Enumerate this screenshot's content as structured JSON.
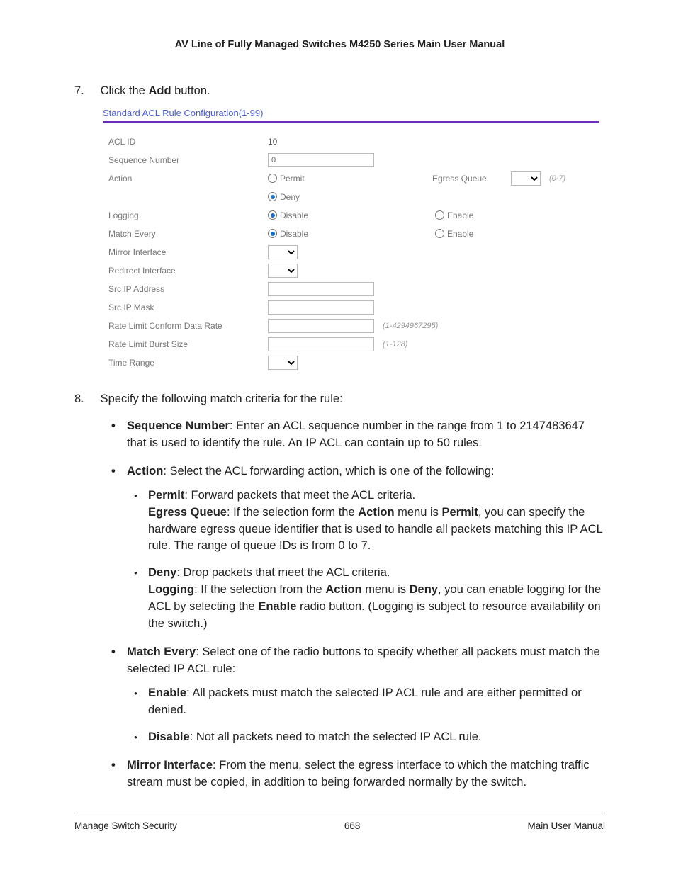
{
  "header": {
    "title": "AV Line of Fully Managed Switches M4250 Series Main User Manual"
  },
  "step7": {
    "num": "7.",
    "pre": "Click the ",
    "bold": "Add",
    "post": " button."
  },
  "panel": {
    "title": "Standard ACL Rule Configuration(1-99)",
    "rows": {
      "acl_id": {
        "label": "ACL ID",
        "value": "10"
      },
      "seq": {
        "label": "Sequence Number",
        "value": "0"
      },
      "action": {
        "label": "Action",
        "opt1": "Permit",
        "opt2": "Deny",
        "right_label": "Egress Queue",
        "hint": "(0-7)"
      },
      "logging": {
        "label": "Logging",
        "opt1": "Disable",
        "opt2": "Enable"
      },
      "match_every": {
        "label": "Match Every",
        "opt1": "Disable",
        "opt2": "Enable"
      },
      "mirror": {
        "label": "Mirror Interface"
      },
      "redirect": {
        "label": "Redirect Interface"
      },
      "srcip": {
        "label": "Src IP Address"
      },
      "srcmask": {
        "label": "Src IP Mask"
      },
      "rate_data": {
        "label": "Rate Limit Conform Data Rate",
        "hint": "(1-4294967295)"
      },
      "rate_burst": {
        "label": "Rate Limit Burst Size",
        "hint": "(1-128)"
      },
      "time_range": {
        "label": "Time Range"
      }
    }
  },
  "step8": {
    "num": "8.",
    "text": "Specify the following match criteria for the rule:",
    "items": [
      {
        "bold": "Sequence Number",
        "text": ": Enter an ACL sequence number in the range from 1 to 2147483647 that is used to identify the rule. An IP ACL can contain up to 50 rules."
      },
      {
        "bold": "Action",
        "text": ": Select the ACL forwarding action, which is one of the following:",
        "sub": [
          {
            "b1": "Permit",
            "t1": ": Forward packets that meet the ACL criteria.",
            "b2": "Egress Queue",
            "t2a": ": If the selection form the ",
            "b2a": "Action",
            "t2b": " menu is ",
            "b2b": "Permit",
            "t2c": ", you can specify the hardware egress queue identifier that is used to handle all packets matching this IP ACL rule. The range of queue IDs is from 0 to 7."
          },
          {
            "b1": "Deny",
            "t1": ": Drop packets that meet the ACL criteria.",
            "b2": "Logging",
            "t2a": ": If the selection from the ",
            "b2a": "Action",
            "t2b": " menu is ",
            "b2b": "Deny",
            "t2c": ", you can enable logging for the ACL by selecting the ",
            "b2c": "Enable",
            "t2d": " radio button. (Logging is subject to resource availability on the switch.)"
          }
        ]
      },
      {
        "bold": "Match Every",
        "text": ": Select one of the radio buttons to specify whether all packets must match the selected IP ACL rule:",
        "sub2": [
          {
            "b": "Enable",
            "t": ": All packets must match the selected IP ACL rule and are either permitted or denied."
          },
          {
            "b": "Disable",
            "t": ": Not all packets need to match the selected IP ACL rule."
          }
        ]
      },
      {
        "bold": "Mirror Interface",
        "text": ": From the menu, select the egress interface to which the matching traffic stream must be copied, in addition to being forwarded normally by the switch."
      }
    ]
  },
  "footer": {
    "left": "Manage Switch Security",
    "center": "668",
    "right": "Main User Manual"
  }
}
